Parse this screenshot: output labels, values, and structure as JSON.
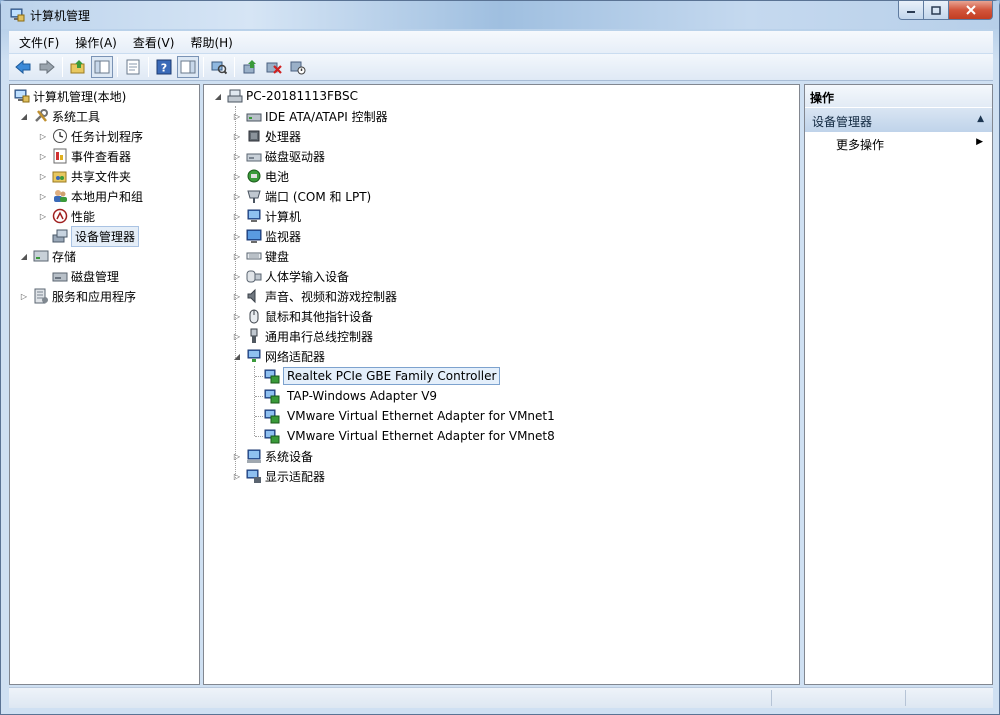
{
  "window": {
    "title": "计算机管理"
  },
  "menubar": {
    "items": [
      "文件(F)",
      "操作(A)",
      "查看(V)",
      "帮助(H)"
    ]
  },
  "toolbar": {
    "buttons": [
      "back-arrow-icon",
      "forward-arrow-icon",
      "up-folder-icon",
      "show-hide-tree-icon",
      "properties-icon",
      "help-icon",
      "show-hide-action-pane-icon",
      "scan-hardware-icon",
      "update-driver-icon",
      "uninstall-device-icon",
      "disable-device-icon"
    ]
  },
  "left_tree": {
    "root": "计算机管理(本地)",
    "items": [
      {
        "label": "系统工具",
        "icon": "tools-icon"
      },
      {
        "label": "任务计划程序",
        "icon": "clock-icon"
      },
      {
        "label": "事件查看器",
        "icon": "event-viewer-icon"
      },
      {
        "label": "共享文件夹",
        "icon": "shared-folder-icon"
      },
      {
        "label": "本地用户和组",
        "icon": "users-icon"
      },
      {
        "label": "性能",
        "icon": "performance-icon"
      },
      {
        "label": "设备管理器",
        "icon": "device-manager-icon"
      },
      {
        "label": "存储",
        "icon": "storage-icon"
      },
      {
        "label": "磁盘管理",
        "icon": "disk-management-icon"
      },
      {
        "label": "服务和应用程序",
        "icon": "services-icon"
      }
    ]
  },
  "device_tree": {
    "root": "PC-20181113FBSC",
    "categories": [
      {
        "label": "IDE ATA/ATAPI 控制器",
        "icon": "ide-controller-icon"
      },
      {
        "label": "处理器",
        "icon": "processor-icon"
      },
      {
        "label": "磁盘驱动器",
        "icon": "disk-drive-icon"
      },
      {
        "label": "电池",
        "icon": "battery-icon"
      },
      {
        "label": "端口 (COM 和 LPT)",
        "icon": "port-icon"
      },
      {
        "label": "计算机",
        "icon": "computer-icon"
      },
      {
        "label": "监视器",
        "icon": "monitor-icon"
      },
      {
        "label": "键盘",
        "icon": "keyboard-icon"
      },
      {
        "label": "人体学输入设备",
        "icon": "hid-icon"
      },
      {
        "label": "声音、视频和游戏控制器",
        "icon": "sound-icon"
      },
      {
        "label": "鼠标和其他指针设备",
        "icon": "mouse-icon"
      },
      {
        "label": "通用串行总线控制器",
        "icon": "usb-icon"
      },
      {
        "label": "网络适配器",
        "icon": "network-adapter-icon"
      }
    ],
    "network_children": [
      "Realtek PCIe GBE Family Controller",
      "TAP-Windows Adapter V9",
      "VMware Virtual Ethernet Adapter for VMnet1",
      "VMware Virtual Ethernet Adapter for VMnet8"
    ],
    "after_categories": [
      {
        "label": "系统设备",
        "icon": "system-devices-icon"
      },
      {
        "label": "显示适配器",
        "icon": "display-adapter-icon"
      }
    ]
  },
  "actions": {
    "title": "操作",
    "section": "设备管理器",
    "item": "更多操作"
  },
  "colors": {
    "selection_border": "#7da2ce",
    "selection_bg": "#e4effb",
    "section_header": "#bfd3ea"
  }
}
